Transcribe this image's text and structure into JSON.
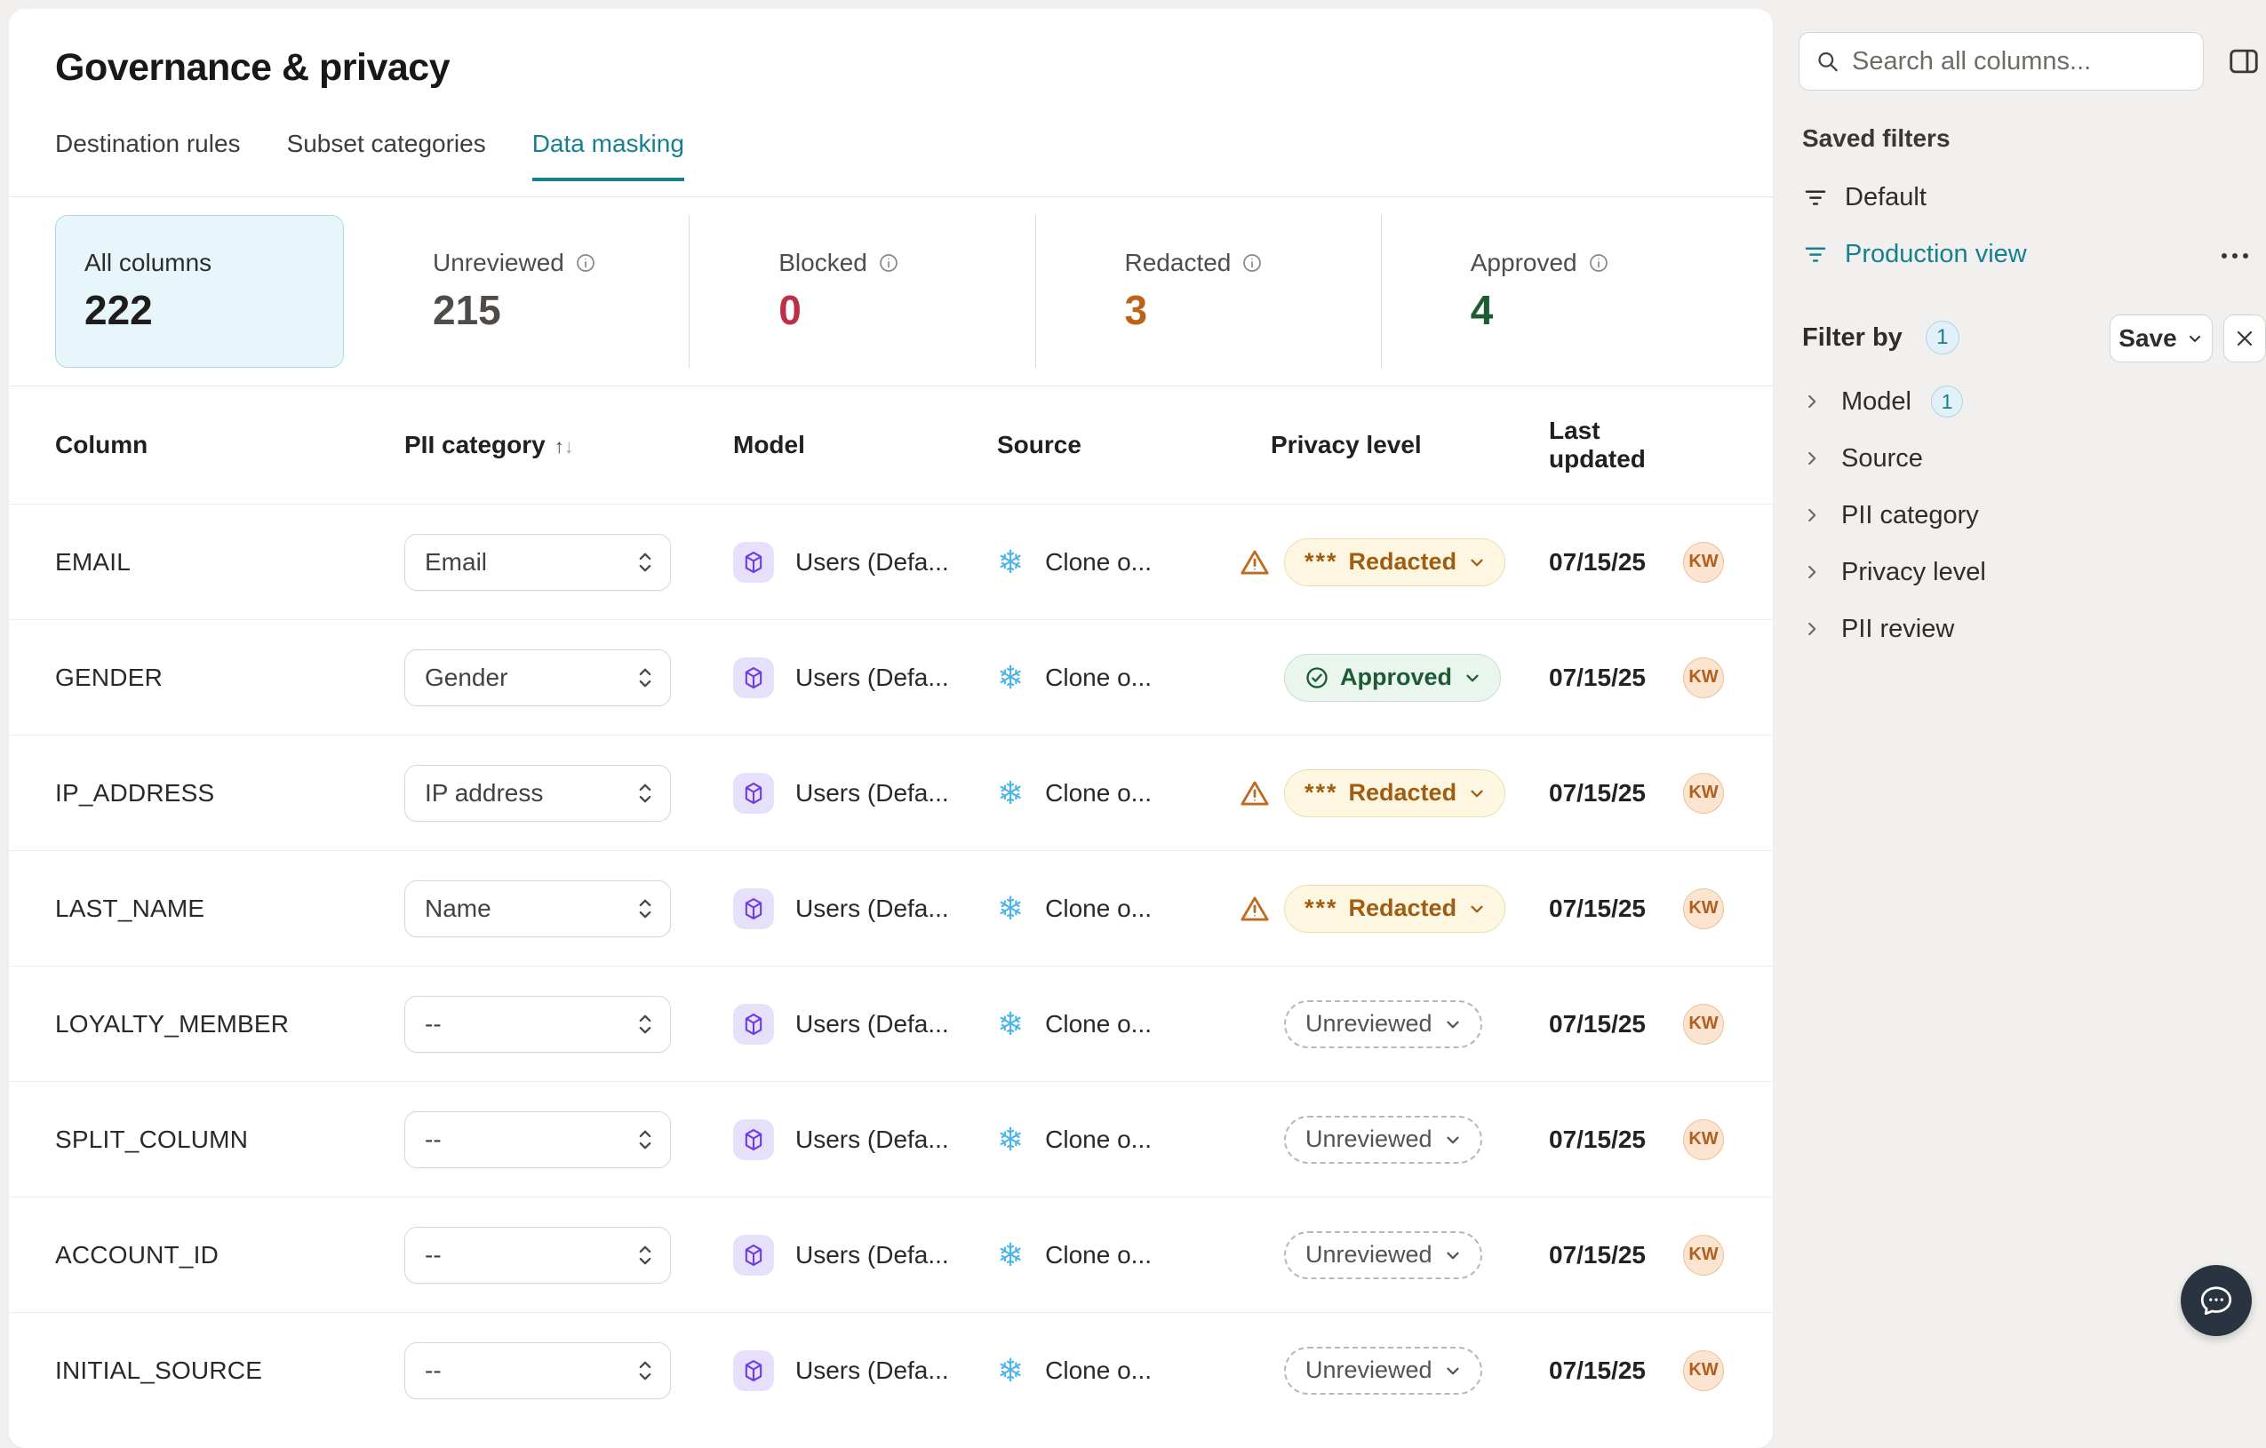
{
  "page": {
    "title": "Governance & privacy"
  },
  "tabs": [
    {
      "label": "Destination rules",
      "active": false
    },
    {
      "label": "Subset categories",
      "active": false
    },
    {
      "label": "Data masking",
      "active": true
    }
  ],
  "stats": {
    "all_columns": {
      "label": "All columns",
      "value": "222"
    },
    "items": [
      {
        "label": "Unreviewed",
        "value": "215",
        "color": "#4f4b48"
      },
      {
        "label": "Blocked",
        "value": "0",
        "color": "#bb3046"
      },
      {
        "label": "Redacted",
        "value": "3",
        "color": "#bc6317"
      },
      {
        "label": "Approved",
        "value": "4",
        "color": "#1c5c33"
      }
    ]
  },
  "table": {
    "headers": {
      "column": "Column",
      "pii": "PII category",
      "model": "Model",
      "source": "Source",
      "privacy": "Privacy level",
      "updated": "Last updated"
    },
    "rows": [
      {
        "column": "EMAIL",
        "pii": "Email",
        "model": "Users (Defa...",
        "source": "Clone o...",
        "privacy_state": "redacted",
        "privacy_label": "Redacted",
        "privacy_prefix": "***",
        "warning": true,
        "updated": "07/15/25",
        "avatar": "KW"
      },
      {
        "column": "GENDER",
        "pii": "Gender",
        "model": "Users (Defa...",
        "source": "Clone o...",
        "privacy_state": "approved",
        "privacy_label": "Approved",
        "privacy_prefix": "",
        "warning": false,
        "updated": "07/15/25",
        "avatar": "KW"
      },
      {
        "column": "IP_ADDRESS",
        "pii": "IP address",
        "model": "Users (Defa...",
        "source": "Clone o...",
        "privacy_state": "redacted",
        "privacy_label": "Redacted",
        "privacy_prefix": "***",
        "warning": true,
        "updated": "07/15/25",
        "avatar": "KW"
      },
      {
        "column": "LAST_NAME",
        "pii": "Name",
        "model": "Users (Defa...",
        "source": "Clone o...",
        "privacy_state": "redacted",
        "privacy_label": "Redacted",
        "privacy_prefix": "***",
        "warning": true,
        "updated": "07/15/25",
        "avatar": "KW"
      },
      {
        "column": "LOYALTY_MEMBER",
        "pii": "--",
        "model": "Users (Defa...",
        "source": "Clone o...",
        "privacy_state": "unreviewed",
        "privacy_label": "Unreviewed",
        "privacy_prefix": "",
        "warning": false,
        "updated": "07/15/25",
        "avatar": "KW"
      },
      {
        "column": "SPLIT_COLUMN",
        "pii": "--",
        "model": "Users (Defa...",
        "source": "Clone o...",
        "privacy_state": "unreviewed",
        "privacy_label": "Unreviewed",
        "privacy_prefix": "",
        "warning": false,
        "updated": "07/15/25",
        "avatar": "KW"
      },
      {
        "column": "ACCOUNT_ID",
        "pii": "--",
        "model": "Users (Defa...",
        "source": "Clone o...",
        "privacy_state": "unreviewed",
        "privacy_label": "Unreviewed",
        "privacy_prefix": "",
        "warning": false,
        "updated": "07/15/25",
        "avatar": "KW"
      },
      {
        "column": "INITIAL_SOURCE",
        "pii": "--",
        "model": "Users (Defa...",
        "source": "Clone o...",
        "privacy_state": "unreviewed",
        "privacy_label": "Unreviewed",
        "privacy_prefix": "",
        "warning": false,
        "updated": "07/15/25",
        "avatar": "KW"
      }
    ]
  },
  "sidebar": {
    "search_placeholder": "Search all columns...",
    "saved_filters_title": "Saved filters",
    "saved_filters": [
      {
        "label": "Default",
        "active": false,
        "menu": false
      },
      {
        "label": "Production view",
        "active": true,
        "menu": true
      }
    ],
    "filter_by": {
      "label": "Filter by",
      "count": "1",
      "save_label": "Save"
    },
    "filter_groups": [
      {
        "label": "Model",
        "count": "1"
      },
      {
        "label": "Source",
        "count": ""
      },
      {
        "label": "PII category",
        "count": ""
      },
      {
        "label": "Privacy level",
        "count": ""
      },
      {
        "label": "PII review",
        "count": ""
      }
    ]
  },
  "colors": {
    "accent_teal": "#17808f",
    "redacted_text": "#a05c10",
    "approved_text": "#1d5b36",
    "blocked_value": "#bb3046",
    "redacted_value": "#bc6317",
    "approved_value": "#1c5c33",
    "snowflake_blue": "#4eb5e8",
    "model_purple": "#6d3be8"
  }
}
